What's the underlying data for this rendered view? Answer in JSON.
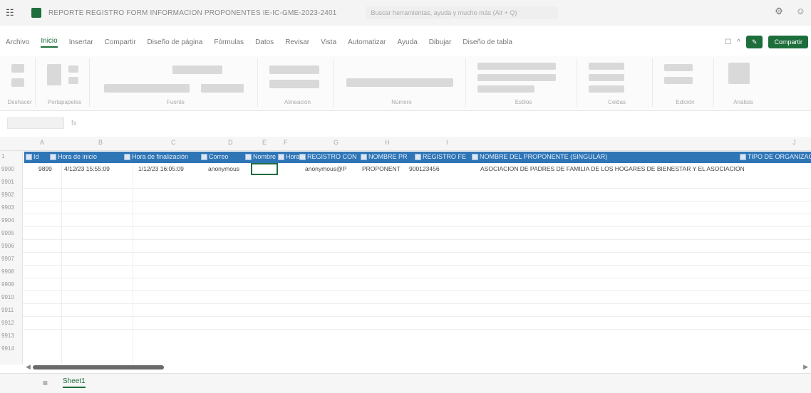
{
  "titlebar": {
    "waffle_glyph": "☷",
    "document_title": "REPORTE REGISTRO FORM INFORMACION PROPONENTES IE-IC-GME-2023-2401",
    "search_placeholder": "Buscar herramientas, ayuda y mucho más (Alt + Q)",
    "settings_glyph": "⚙",
    "profile_glyph": "☺"
  },
  "menu": {
    "tabs": [
      "Archivo",
      "Inicio",
      "Insertar",
      "Compartir",
      "Diseño de página",
      "Fórmulas",
      "Datos",
      "Revisar",
      "Vista",
      "Automatizar",
      "Ayuda",
      "Dibujar",
      "Diseño de tabla"
    ],
    "active_tab": "Inicio",
    "comment_glyph": "☐",
    "collapse_glyph": "^",
    "editing_label": "✎",
    "share_label": "Compartir"
  },
  "ribbon": {
    "groups": [
      "Deshacer",
      "Portapapeles",
      "Fuente",
      "Alineación",
      "Número",
      "Estilos",
      "Celdas",
      "Edición",
      "Análisis"
    ]
  },
  "formula_bar": {
    "fx_glyph": "fx"
  },
  "grid": {
    "column_letters": [
      "A",
      "B",
      "C",
      "D",
      "E",
      "F",
      "G",
      "H",
      "I",
      "J"
    ],
    "row_numbers": [
      "1",
      "9900",
      "9901",
      "9902",
      "9903",
      "9904",
      "9905",
      "9906",
      "9907",
      "9908",
      "9909",
      "9910",
      "9911",
      "9912",
      "9913",
      "9914"
    ],
    "table_headers": [
      "Id",
      "Hora de inicio",
      "Hora de finalización",
      "Correo",
      "Nombre",
      "Hora",
      "REGISTRO CON",
      "NOMBRE PR",
      "REGISTRO FE",
      "NOMBRE DEL PROPONENTE (SINGULAR)",
      "TIPO DE ORGANIZACIÓN"
    ],
    "data_row": [
      "9899",
      "4/12/23 15:55:09",
      "1/12/23 16:05:09",
      "anonymous",
      "",
      "",
      "anonymous@P",
      "PROPONENT",
      "900123456",
      "ASOCIACION DE PADRES DE FAMILIA DE LOS HOGARES DE BIENESTAR Y EL ASOCIACION",
      ""
    ]
  },
  "sheets": {
    "menu_glyph": "≡",
    "active_sheet": "Sheet1"
  },
  "colors": {
    "accent": "#1e6e3c",
    "table_header": "#2e75b6"
  }
}
